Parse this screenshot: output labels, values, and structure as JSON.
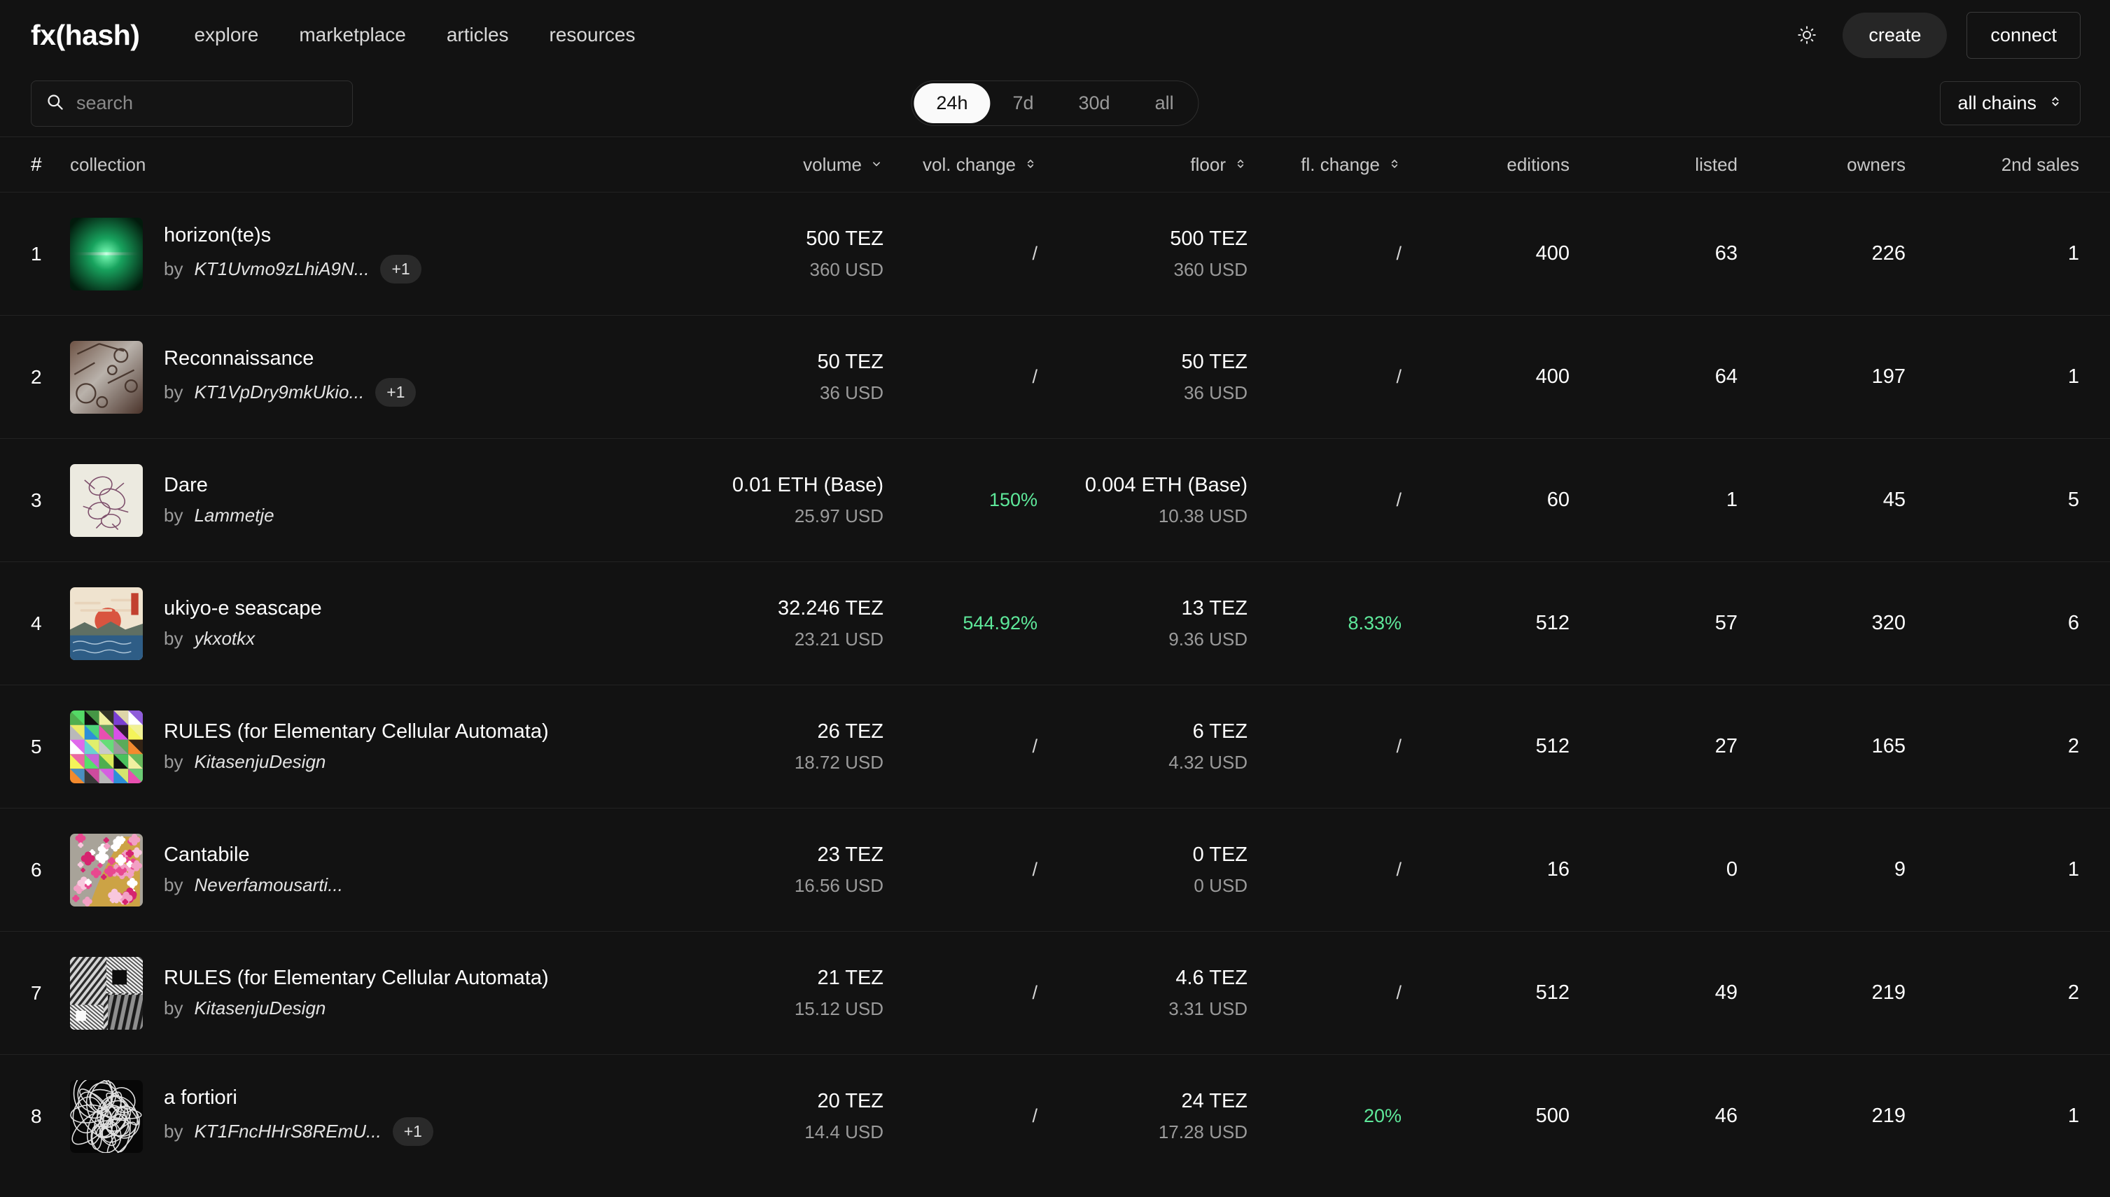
{
  "header": {
    "brand": "fx(hash)",
    "nav": [
      {
        "label": "explore"
      },
      {
        "label": "marketplace"
      },
      {
        "label": "articles"
      },
      {
        "label": "resources"
      }
    ],
    "theme_icon": "sun-icon",
    "create_label": "create",
    "connect_label": "connect"
  },
  "filters": {
    "search_placeholder": "search",
    "search_value": "",
    "search_icon": "search-icon",
    "periods": [
      {
        "label": "24h",
        "active": true
      },
      {
        "label": "7d",
        "active": false
      },
      {
        "label": "30d",
        "active": false
      },
      {
        "label": "all",
        "active": false
      }
    ],
    "chain_selected": "all chains",
    "chain_icon": "chevron-up-down-icon"
  },
  "table": {
    "columns": {
      "rank": "#",
      "collection": "collection",
      "volume": "volume",
      "vol_change": "vol. change",
      "floor": "floor",
      "fl_change": "fl. change",
      "editions": "editions",
      "listed": "listed",
      "owners": "owners",
      "second_sales": "2nd sales"
    },
    "sort": {
      "volume_icon": "chevron-down-icon",
      "vol_change_icon": "chevron-up-down-icon",
      "floor_icon": "chevron-up-down-icon",
      "fl_change_icon": "chevron-up-down-icon"
    },
    "empty_value": "/",
    "rows": [
      {
        "rank": "1",
        "name": "horizon(te)s",
        "by_label": "by",
        "author": "KT1Uvmo9zLhiA9N...",
        "badge": "+1",
        "volume": "500 TEZ",
        "volume_usd": "360 USD",
        "vol_change": "/",
        "vol_change_up": false,
        "floor": "500 TEZ",
        "floor_usd": "360 USD",
        "fl_change": "/",
        "fl_change_up": false,
        "editions": "400",
        "listed": "63",
        "owners": "226",
        "second_sales": "1",
        "thumb": "green-horizon-beam"
      },
      {
        "rank": "2",
        "name": "Reconnaissance",
        "by_label": "by",
        "author": "KT1VpDry9mkUkio...",
        "badge": "+1",
        "volume": "50 TEZ",
        "volume_usd": "36 USD",
        "vol_change": "/",
        "vol_change_up": false,
        "floor": "50 TEZ",
        "floor_usd": "36 USD",
        "fl_change": "/",
        "fl_change_up": false,
        "editions": "400",
        "listed": "64",
        "owners": "197",
        "second_sales": "1",
        "thumb": "sepia-machinery"
      },
      {
        "rank": "3",
        "name": "Dare",
        "by_label": "by",
        "author": "Lammetje",
        "badge": "",
        "volume": "0.01 ETH (Base)",
        "volume_usd": "25.97 USD",
        "vol_change": "150%",
        "vol_change_up": true,
        "floor": "0.004 ETH (Base)",
        "floor_usd": "10.38 USD",
        "fl_change": "/",
        "fl_change_up": false,
        "editions": "60",
        "listed": "1",
        "owners": "45",
        "second_sales": "5",
        "thumb": "cream-purple-scribble"
      },
      {
        "rank": "4",
        "name": "ukiyo-e seascape",
        "by_label": "by",
        "author": "ykxotkx",
        "badge": "",
        "volume": "32.246 TEZ",
        "volume_usd": "23.21 USD",
        "vol_change": "544.92%",
        "vol_change_up": true,
        "floor": "13 TEZ",
        "floor_usd": "9.36 USD",
        "fl_change": "8.33%",
        "fl_change_up": true,
        "editions": "512",
        "listed": "57",
        "owners": "320",
        "second_sales": "6",
        "thumb": "ukiyoe-seascape"
      },
      {
        "rank": "5",
        "name": "RULES (for Elementary Cellular Automata)",
        "by_label": "by",
        "author": "KitasenjuDesign",
        "badge": "",
        "volume": "26 TEZ",
        "volume_usd": "18.72 USD",
        "vol_change": "/",
        "vol_change_up": false,
        "floor": "6 TEZ",
        "floor_usd": "4.32 USD",
        "fl_change": "/",
        "fl_change_up": false,
        "editions": "512",
        "listed": "27",
        "owners": "165",
        "second_sales": "2",
        "thumb": "color-automata-grid"
      },
      {
        "rank": "6",
        "name": "Cantabile",
        "by_label": "by",
        "author": "Neverfamousarti...",
        "badge": "",
        "volume": "23 TEZ",
        "volume_usd": "16.56 USD",
        "vol_change": "/",
        "vol_change_up": false,
        "floor": "0 TEZ",
        "floor_usd": "0 USD",
        "fl_change": "/",
        "fl_change_up": false,
        "editions": "16",
        "listed": "0",
        "owners": "9",
        "second_sales": "1",
        "thumb": "pink-blossoms"
      },
      {
        "rank": "7",
        "name": "RULES (for Elementary Cellular Automata)",
        "by_label": "by",
        "author": "KitasenjuDesign",
        "badge": "",
        "volume": "21 TEZ",
        "volume_usd": "15.12 USD",
        "vol_change": "/",
        "vol_change_up": false,
        "floor": "4.6 TEZ",
        "floor_usd": "3.31 USD",
        "fl_change": "/",
        "fl_change_up": false,
        "editions": "512",
        "listed": "49",
        "owners": "219",
        "second_sales": "2",
        "thumb": "gray-diagonal-stripes"
      },
      {
        "rank": "8",
        "name": "a fortiori",
        "by_label": "by",
        "author": "KT1FncHHrS8REmU...",
        "badge": "+1",
        "volume": "20 TEZ",
        "volume_usd": "14.4 USD",
        "vol_change": "/",
        "vol_change_up": false,
        "floor": "24 TEZ",
        "floor_usd": "17.28 USD",
        "fl_change": "20%",
        "fl_change_up": true,
        "editions": "500",
        "listed": "46",
        "owners": "219",
        "second_sales": "1",
        "thumb": "white-tangle"
      }
    ]
  },
  "colors": {
    "background": "#121212",
    "positive": "#5ee89a",
    "muted": "#9b9b9b",
    "divider": "#222222"
  }
}
